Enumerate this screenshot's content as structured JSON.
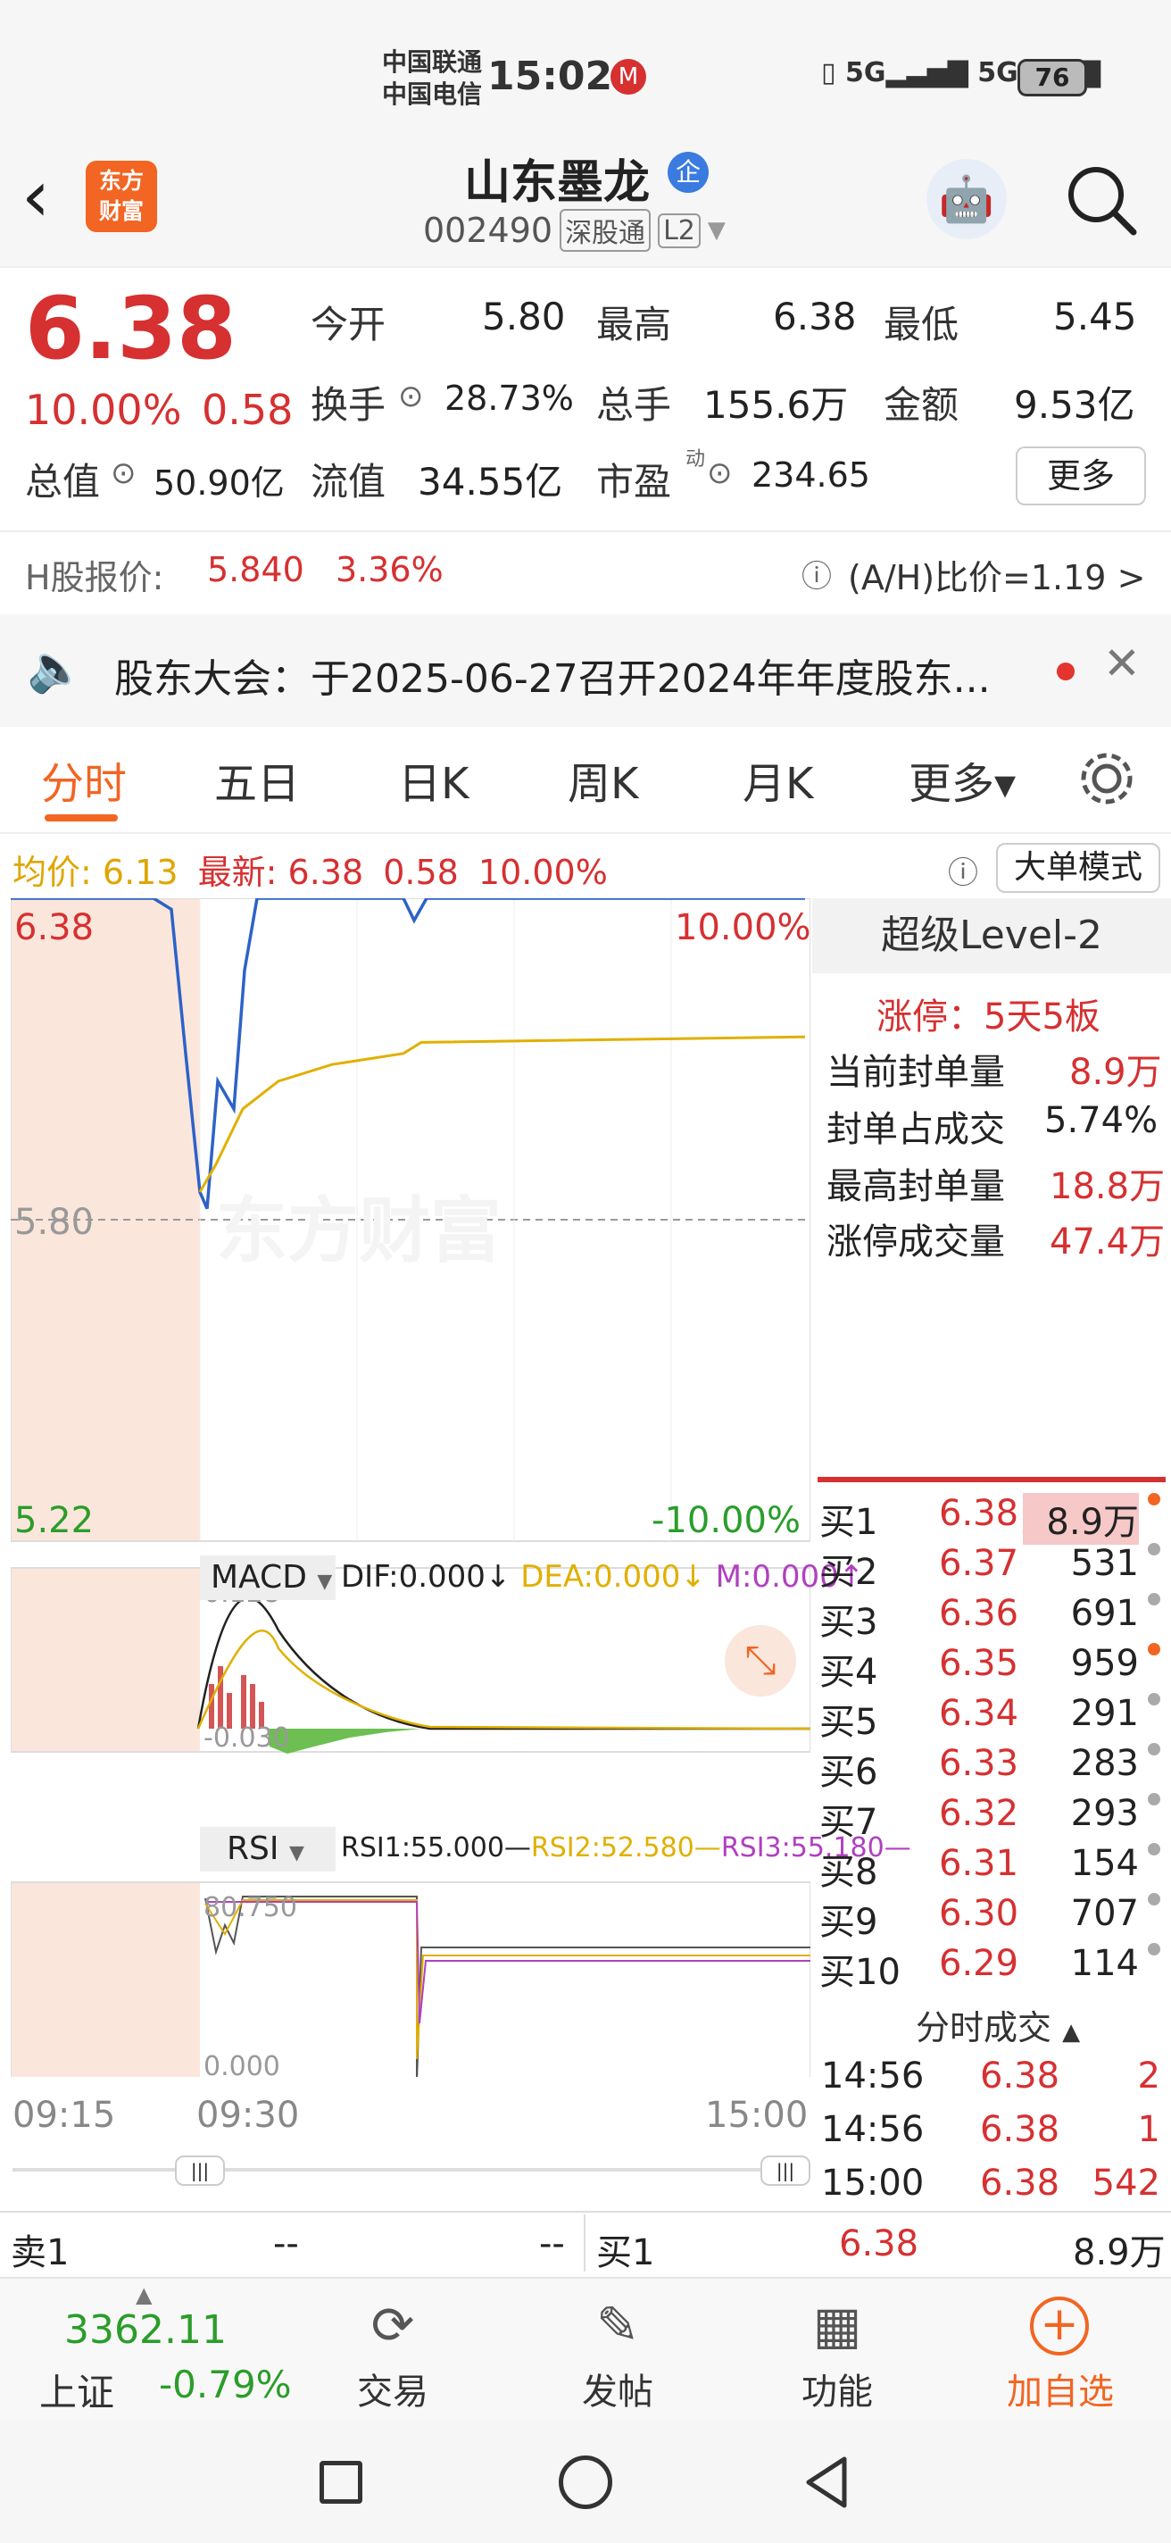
{
  "status_bar": {
    "carrier1": "中国联通",
    "carrier2": "中国电信",
    "time": "15:02",
    "battery": "76",
    "signal1": "5G",
    "signal2": "5G"
  },
  "header": {
    "logo_line1": "东方",
    "logo_line2": "财富",
    "stock_name": "山东墨龙",
    "badge": "企",
    "code": "002490",
    "tag1": "深股通",
    "tag2": "L2"
  },
  "quote": {
    "price": "6.38",
    "change_pct": "10.00%",
    "change": "0.58",
    "open_label": "今开",
    "open": "5.80",
    "high_label": "最高",
    "high": "6.38",
    "low_label": "最低",
    "low": "5.45",
    "turnover_label": "换手",
    "turnover": "28.73%",
    "volume_label": "总手",
    "volume": "155.6万",
    "amount_label": "金额",
    "amount": "9.53亿",
    "mktcap_label": "总值",
    "mktcap": "50.90亿",
    "float_label": "流值",
    "float": "34.55亿",
    "pe_label": "市盈",
    "pe_sup": "动",
    "pe": "234.65",
    "more": "更多"
  },
  "hshare": {
    "label": "H股报价:",
    "price": "5.840",
    "pct": "3.36%",
    "ratio": "(A/H)比价=1.19",
    "arrow": ">"
  },
  "notice": {
    "text": "股东大会：于2025-06-27召开2024年年度股东..."
  },
  "tabs": [
    "分时",
    "五日",
    "日K",
    "周K",
    "月K",
    "更多▾"
  ],
  "info_bar": {
    "avg_label": "均价:",
    "avg": "6.13",
    "latest_label": "最新:",
    "latest": "6.38",
    "chg": "0.58",
    "pct": "10.00%",
    "mode": "大单模式"
  },
  "chart_labels": {
    "top_price": "6.38",
    "top_pct": "10.00%",
    "mid_price": "5.80",
    "bottom_price": "5.22",
    "bottom_pct": "-10.00%",
    "watermark": "东方财富"
  },
  "chart_data": {
    "type": "line",
    "title": "",
    "x": [
      "09:15",
      "09:30",
      "15:00"
    ],
    "ylim": [
      5.22,
      6.38
    ],
    "series": [
      {
        "name": "最新",
        "values": [
          6.38,
          6.38,
          6.36,
          6.1,
          5.85,
          5.82,
          6.05,
          6.0,
          6.25,
          6.38,
          6.38,
          6.34,
          6.38,
          6.38
        ]
      },
      {
        "name": "均价",
        "values": [
          5.85,
          5.9,
          6.0,
          6.05,
          6.08,
          6.1,
          6.12,
          6.13
        ]
      }
    ]
  },
  "macd": {
    "name": "MACD",
    "dif": "DIF:0.000↓",
    "dea": "DEA:0.000↓",
    "m": "M:0.000↑",
    "hi": "0.128",
    "lo": "-0.030"
  },
  "rsi": {
    "name": "RSI",
    "r1": "RSI1:55.000—",
    "r2": "RSI2:52.580—",
    "r3": "RSI3:55.180—",
    "hi": "80.750",
    "lo": "0.000"
  },
  "time_axis": {
    "t1": "09:15",
    "t2": "09:30",
    "t3": "15:00"
  },
  "level2": {
    "title": "超级Level-2",
    "limit": "涨停：5天5板",
    "rows": [
      {
        "label": "当前封单量",
        "value": "8.9万"
      },
      {
        "label": "封单占成交",
        "value": "5.74%"
      },
      {
        "label": "最高封单量",
        "value": "18.8万"
      },
      {
        "label": "涨停成交量",
        "value": "47.4万"
      }
    ]
  },
  "order_book": [
    {
      "label": "买1",
      "price": "6.38",
      "vol": "8.9万"
    },
    {
      "label": "买2",
      "price": "6.37",
      "vol": "531"
    },
    {
      "label": "买3",
      "price": "6.36",
      "vol": "691"
    },
    {
      "label": "买4",
      "price": "6.35",
      "vol": "959"
    },
    {
      "label": "买5",
      "price": "6.34",
      "vol": "291"
    },
    {
      "label": "买6",
      "price": "6.33",
      "vol": "283"
    },
    {
      "label": "买7",
      "price": "6.32",
      "vol": "293"
    },
    {
      "label": "买8",
      "price": "6.31",
      "vol": "154"
    },
    {
      "label": "买9",
      "price": "6.30",
      "vol": "707"
    },
    {
      "label": "买10",
      "price": "6.29",
      "vol": "114"
    }
  ],
  "ticks": {
    "title": "分时成交",
    "rows": [
      {
        "time": "14:56",
        "price": "6.38",
        "vol": "2"
      },
      {
        "time": "14:56",
        "price": "6.38",
        "vol": "1"
      },
      {
        "time": "15:00",
        "price": "6.38",
        "vol": "542"
      }
    ]
  },
  "bottom_quote": {
    "sell_label": "卖1",
    "sell_p": "--",
    "sell_v": "--",
    "buy_label": "买1",
    "buy_p": "6.38",
    "buy_v": "8.9万"
  },
  "bottom_nav": {
    "index_value": "3362.11",
    "index_name": "上证",
    "index_pct": "-0.79%",
    "trade": "交易",
    "post": "发帖",
    "func": "功能",
    "add": "加自选"
  }
}
